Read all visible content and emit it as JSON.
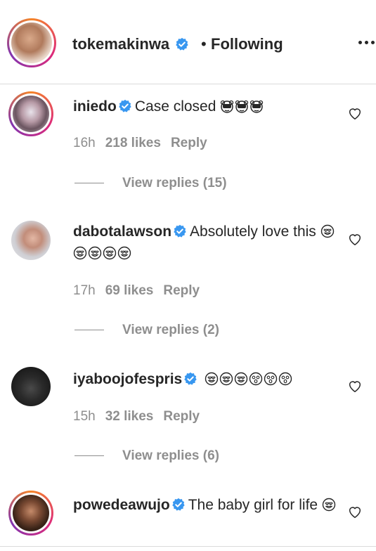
{
  "post": {
    "author": "tokemakinwa",
    "separator": "•",
    "follow_status": "Following",
    "more_icon": "more-horizontal-icon"
  },
  "comments": [
    {
      "username": "iniedo",
      "text": "Case closed",
      "emoji": "🙉🙉🙉",
      "time": "16h",
      "likes": "218 likes",
      "reply": "Reply",
      "view_replies": "View replies (15)"
    },
    {
      "username": "dabotalawson",
      "text": "Absolutely love this",
      "emoji": "😍😍😍😍😍",
      "time": "17h",
      "likes": "69 likes",
      "reply": "Reply",
      "view_replies": "View replies (2)"
    },
    {
      "username": "iyaboojofespris",
      "text": "",
      "emoji": "😍😍😍😮😮😮",
      "time": "15h",
      "likes": "32 likes",
      "reply": "Reply",
      "view_replies": "View replies (6)"
    },
    {
      "username": "powedeawujo",
      "text": "The baby girl for life",
      "emoji": "😍",
      "time": "",
      "likes": "",
      "reply": "",
      "view_replies": ""
    }
  ],
  "colors": {
    "text": "#262626",
    "muted": "#8e8e8e",
    "verified": "#3897f0",
    "divider": "#dbdbdb"
  }
}
